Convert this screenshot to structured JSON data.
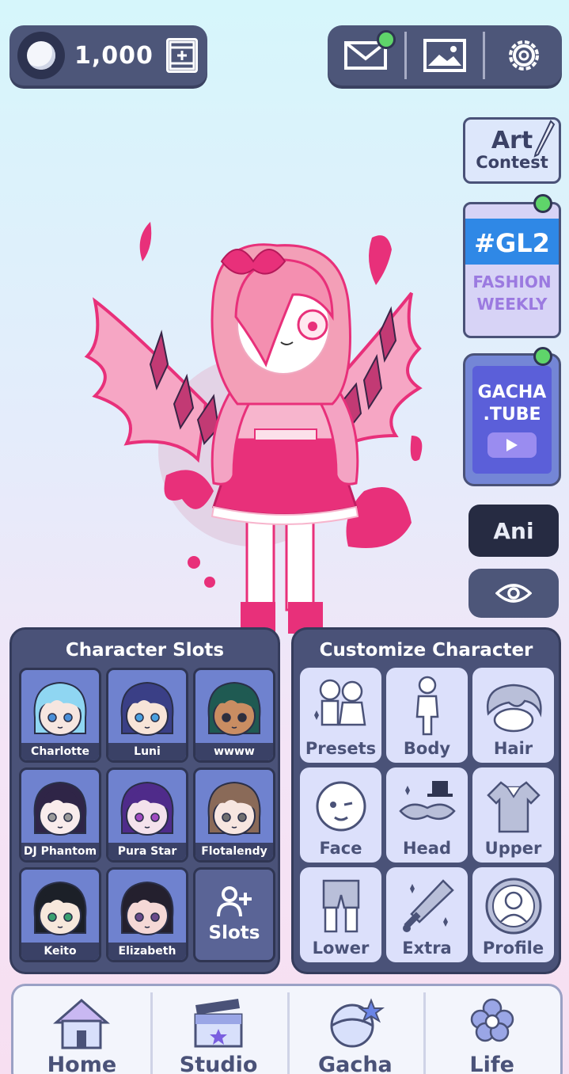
{
  "currency": {
    "amount": "1,000",
    "add_icon": "film-plus-icon"
  },
  "top_buttons": [
    {
      "name": "mail",
      "icon": "envelope-icon",
      "has_notification": true
    },
    {
      "name": "gallery",
      "icon": "image-icon"
    },
    {
      "name": "settings",
      "icon": "gear-icon"
    }
  ],
  "side": {
    "art_contest": {
      "line1": "Art",
      "line2": "Contest"
    },
    "gl2": {
      "tag": "#GL2",
      "line1": "FASHION",
      "line2": "WEEKLY"
    },
    "gacha_tube": {
      "line1": "GACHA",
      "line2": ".TUBE"
    },
    "ani_label": "Ani"
  },
  "slots_panel": {
    "title": "Character Slots",
    "slots": [
      {
        "name": "Charlotte",
        "hair": "#8fd6f2",
        "skin": "#f6e6e0",
        "eyes": "#4a8fd8"
      },
      {
        "name": "Luni",
        "hair": "#3a3f86",
        "skin": "#f7e4d8",
        "eyes": "#4aa0e0"
      },
      {
        "name": "wwww",
        "hair": "#1f5a52",
        "skin": "#c98d62",
        "eyes": "#2f2f3a"
      },
      {
        "name": "DJ Phantom",
        "hair": "#2f2547",
        "skin": "#f9ecec",
        "eyes": "#9a9a9a"
      },
      {
        "name": "Pura Star",
        "hair": "#4f2b8a",
        "skin": "#f4e2ec",
        "eyes": "#a04ac0"
      },
      {
        "name": "Flotalendy",
        "hair": "#8a6a58",
        "skin": "#f7e6e0",
        "eyes": "#6f6f6f"
      },
      {
        "name": "Keito",
        "hair": "#1c2028",
        "skin": "#f7e8dc",
        "eyes": "#3aa070"
      },
      {
        "name": "Elizabeth",
        "hair": "#24202e",
        "skin": "#f5d8d6",
        "eyes": "#6a4a8a"
      }
    ],
    "add_label": "Slots"
  },
  "customize_panel": {
    "title": "Customize Character",
    "items": [
      {
        "label": "Presets",
        "icon": "presets-icon"
      },
      {
        "label": "Body",
        "icon": "body-icon"
      },
      {
        "label": "Hair",
        "icon": "hair-icon"
      },
      {
        "label": "Face",
        "icon": "face-icon"
      },
      {
        "label": "Head",
        "icon": "head-accessory-icon"
      },
      {
        "label": "Upper",
        "icon": "shirt-icon"
      },
      {
        "label": "Lower",
        "icon": "pants-icon"
      },
      {
        "label": "Extra",
        "icon": "sword-icon"
      },
      {
        "label": "Profile",
        "icon": "profile-icon"
      }
    ]
  },
  "bottom_nav": [
    {
      "label": "Home",
      "icon": "house-icon"
    },
    {
      "label": "Studio",
      "icon": "clapperboard-icon"
    },
    {
      "label": "Gacha",
      "icon": "gacha-ball-icon"
    },
    {
      "label": "Life",
      "icon": "flower-icon"
    }
  ],
  "colors": {
    "panel": "#4a5278",
    "accent_pink": "#e8307a",
    "notification": "#5fd46a"
  }
}
